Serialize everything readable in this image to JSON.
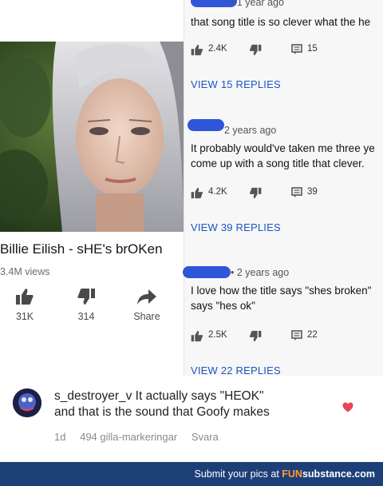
{
  "video": {
    "title": "Billie Eilish - sHE's brOKen",
    "views": "3.4M views",
    "actions": [
      {
        "icon": "thumbs-up-icon",
        "label": "31K"
      },
      {
        "icon": "thumbs-down-icon",
        "label": "314"
      },
      {
        "icon": "share-arrow-icon",
        "label": "Share"
      }
    ]
  },
  "comments": [
    {
      "time": "• 1 year ago",
      "lines": [
        "that song title is so clever what the he"
      ],
      "likes": "2.4K",
      "reply_count": "15",
      "view_replies": "VIEW 15 REPLIES"
    },
    {
      "time": "2 years ago",
      "lines": [
        "It probably would've taken me three ye",
        "come up with a song title that clever."
      ],
      "likes": "4.2K",
      "reply_count": "39",
      "view_replies": "VIEW 39 REPLIES"
    },
    {
      "time": "• 2 years ago",
      "lines": [
        "I love how the title says \"shes broken\"",
        "says \"hes ok\""
      ],
      "likes": "2.5K",
      "reply_count": "22",
      "view_replies": "VIEW 22 REPLIES"
    }
  ],
  "bottom_comment": {
    "username": "s_destroyer_v",
    "text_line1": " It actually says \"HEOK\"",
    "text_line2": "and that is the sound that Goofy makes",
    "age": "1d",
    "likes": "494 gilla-markeringar",
    "reply": "Svara",
    "heart_color": "#e8455a"
  },
  "footer": {
    "prefix": "Submit your pics at ",
    "brand_fun": "FUN",
    "brand_rest": "substance",
    "suffix": ".com"
  },
  "colors": {
    "redaction": "#2f56d8",
    "link_blue": "#1c55c7",
    "footer_bg": "#1d3f78",
    "footer_accent": "#ff9a32"
  }
}
